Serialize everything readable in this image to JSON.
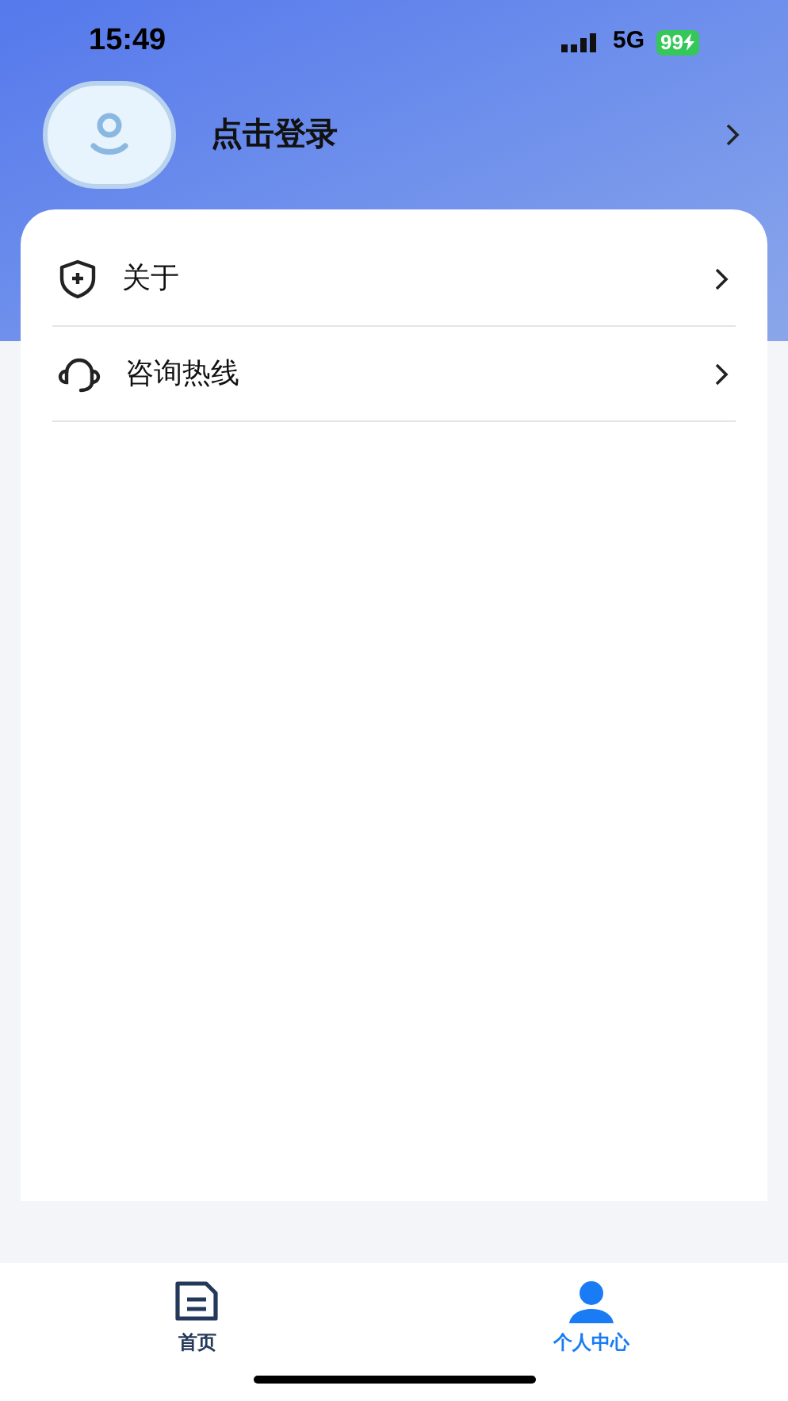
{
  "status_bar": {
    "time": "15:49",
    "network": "5G",
    "battery": "99"
  },
  "profile": {
    "login_label": "点击登录"
  },
  "menu": [
    {
      "kind": "about",
      "label": "关于"
    },
    {
      "kind": "hotline",
      "label": "咨询热线"
    }
  ],
  "tab_bar": [
    {
      "kind": "home",
      "label": "首页",
      "selected": false
    },
    {
      "kind": "profile",
      "label": "个人中心",
      "selected": true
    }
  ]
}
